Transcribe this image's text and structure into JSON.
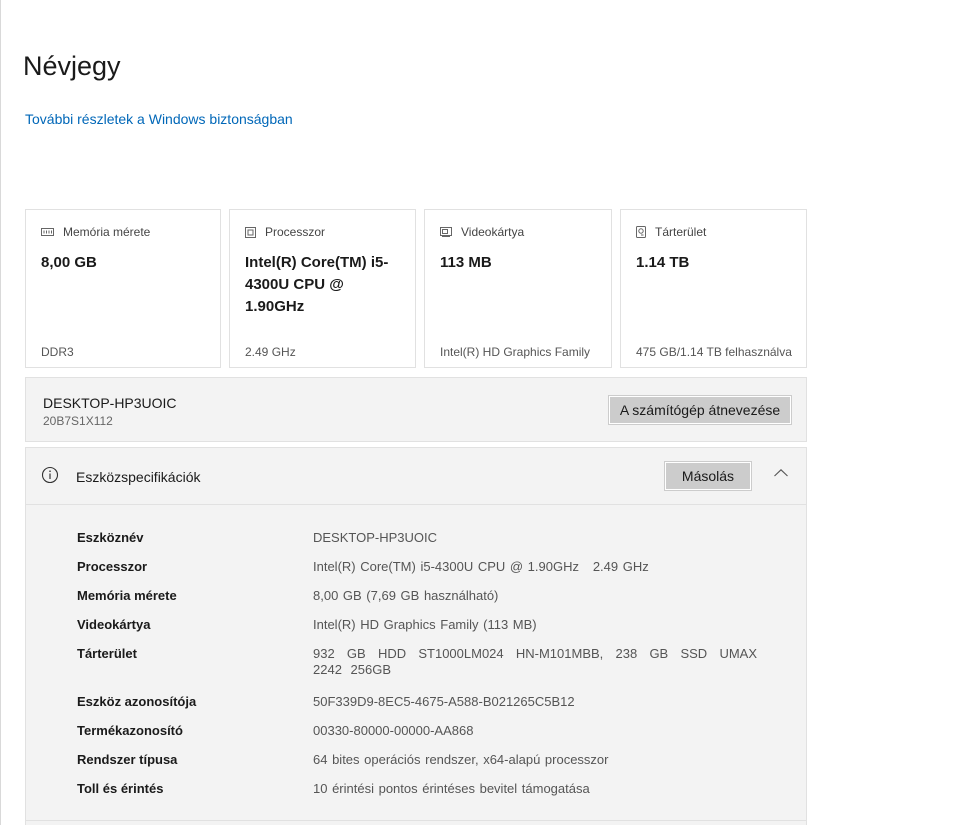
{
  "header": {
    "title": "Névjegy",
    "security_link": "További részletek a Windows biztonságban"
  },
  "cards": [
    {
      "title": "Memória mérete",
      "value": "8,00 GB",
      "sub": "DDR3",
      "icon": "memory-icon"
    },
    {
      "title": "Processzor",
      "value": "Intel(R) Core(TM) i5-4300U CPU @ 1.90GHz",
      "sub": "2.49 GHz",
      "icon": "processor-icon"
    },
    {
      "title": "Videokártya",
      "value": "113 MB",
      "sub": "Intel(R) HD Graphics Family",
      "icon": "graphics-card-icon"
    },
    {
      "title": "Tárterület",
      "value": "1.14 TB",
      "sub": "475 GB/1.14 TB felhasználva",
      "icon": "storage-icon"
    }
  ],
  "device": {
    "name": "DESKTOP-HP3UOIC",
    "model": "20B7S1X112",
    "rename_label": "A számítógép átnevezése"
  },
  "specs": {
    "title": "Eszközspecifikációk",
    "copy_label": "Másolás",
    "rows": [
      {
        "label": "Eszköznév",
        "value": "DESKTOP-HP3UOIC"
      },
      {
        "label": "Processzor",
        "value": "Intel(R) Core(TM) i5-4300U CPU @ 1.90GHz   2.49 GHz"
      },
      {
        "label": "Memória mérete",
        "value": "8,00 GB (7,69 GB használható)"
      },
      {
        "label": "Videokártya",
        "value": "Intel(R) HD Graphics Family (113 MB)"
      },
      {
        "label": "Tárterület",
        "value": "932 GB HDD ST1000LM024 HN-M101MBB, 238 GB SSD UMAX 2242 256GB"
      },
      {
        "label": "Eszköz azonosítója",
        "value": "50F339D9-8EC5-4675-A588-B021265C5B12"
      },
      {
        "label": "Termékazonosító",
        "value": "00330-80000-00000-AA868"
      },
      {
        "label": "Rendszer típusa",
        "value": "64 bites operációs rendszer, x64-alapú processzor"
      },
      {
        "label": "Toll és érintés",
        "value": "10 érintési pontos érintéses bevitel támogatása"
      }
    ]
  },
  "colors": {
    "link": "#0067b8",
    "button": "#cccccc",
    "panel": "#f3f3f3",
    "border": "#e1e1e1"
  }
}
